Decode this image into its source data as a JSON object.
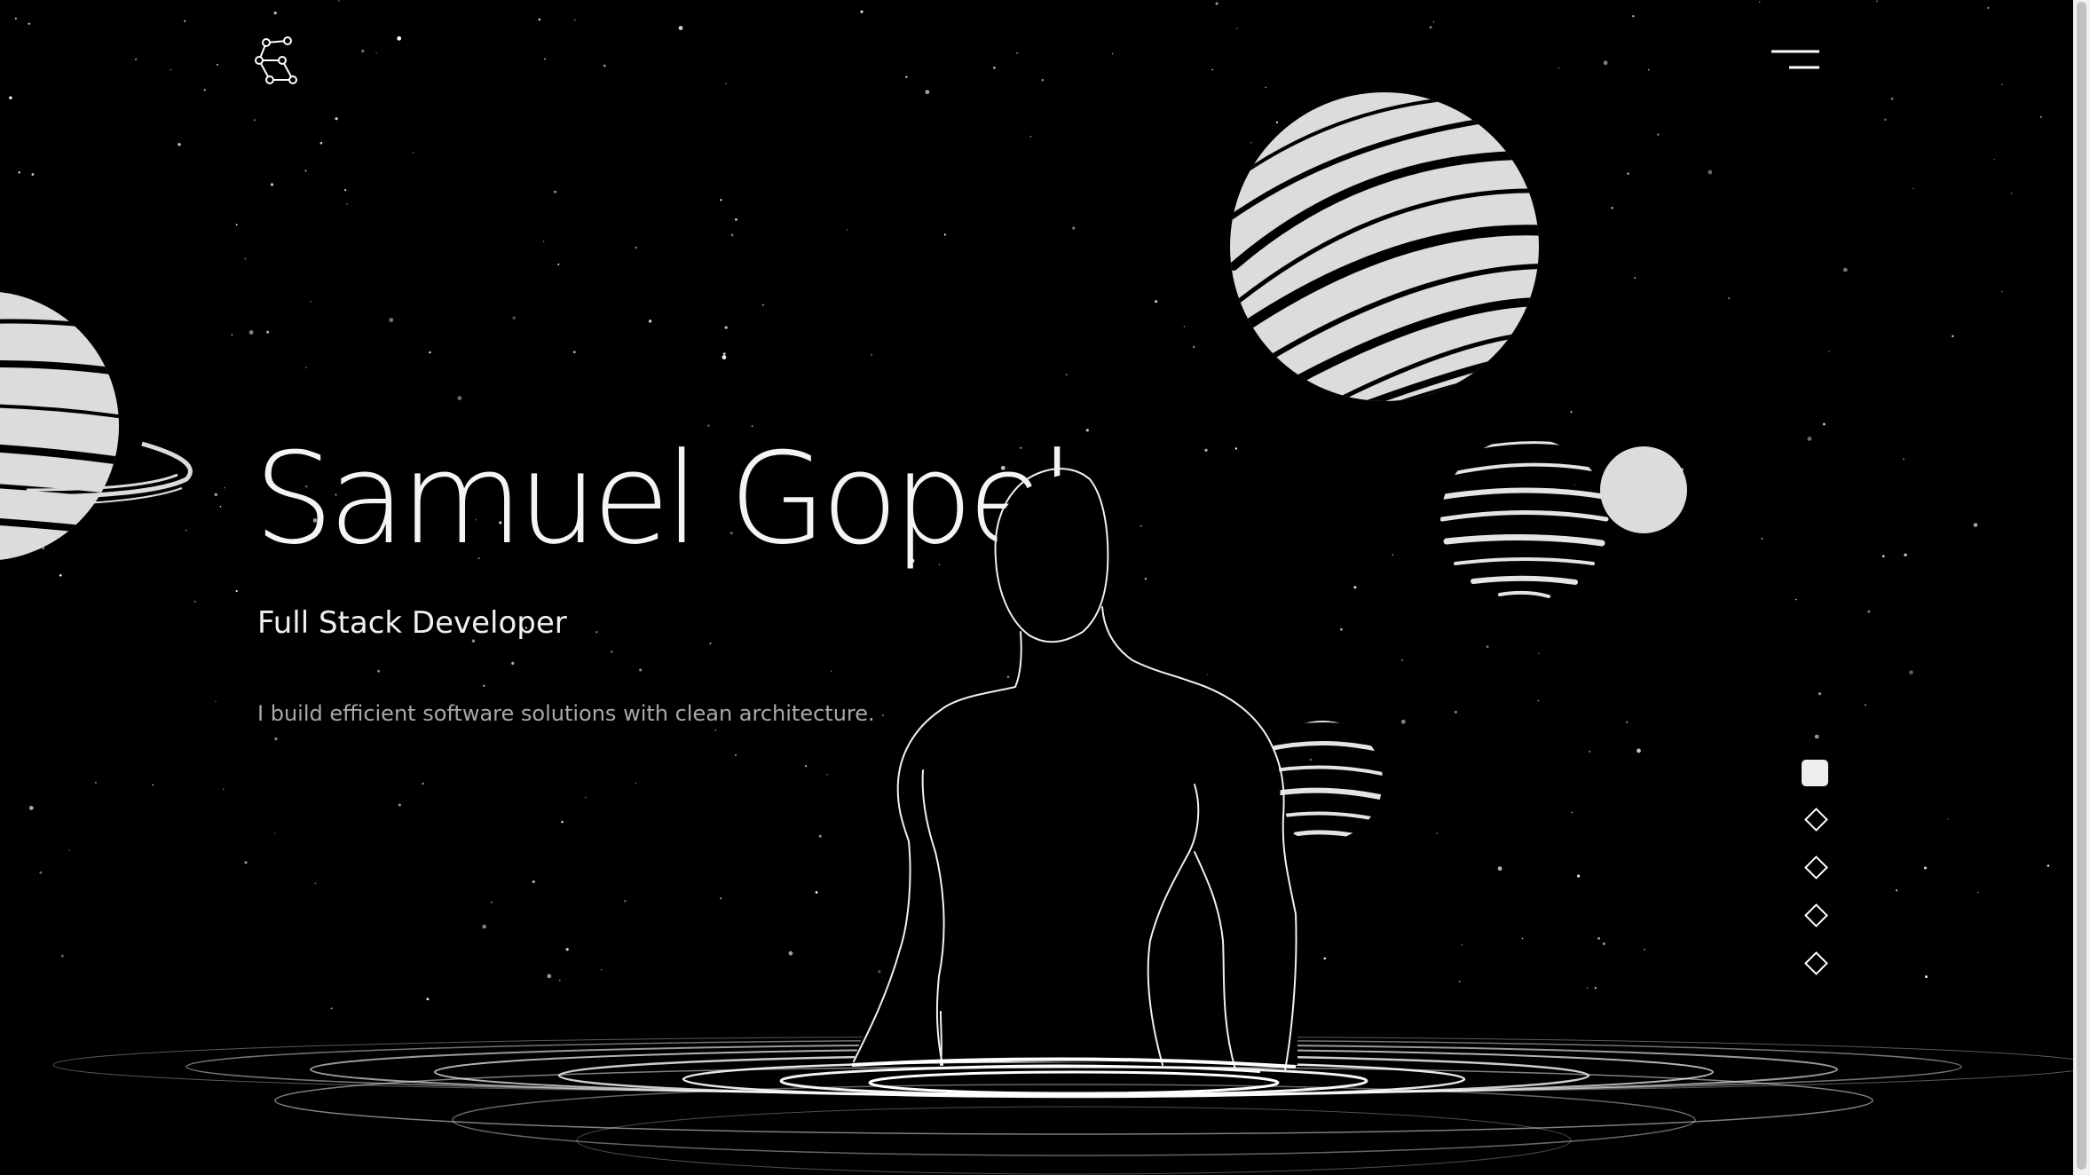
{
  "hero": {
    "name": "Samuel Gopel",
    "role": "Full Stack Developer",
    "description": "I build efficient software solutions with clean architecture."
  },
  "header": {
    "logo_icon": "constellation-icon",
    "menu_icon": "hamburger-menu-icon"
  },
  "section_nav": {
    "count": 5,
    "active_index": 0
  },
  "colors": {
    "background": "#000000",
    "foreground": "#ffffff",
    "planet": "#dcdcdc",
    "muted_text": "#a8a8a8"
  }
}
